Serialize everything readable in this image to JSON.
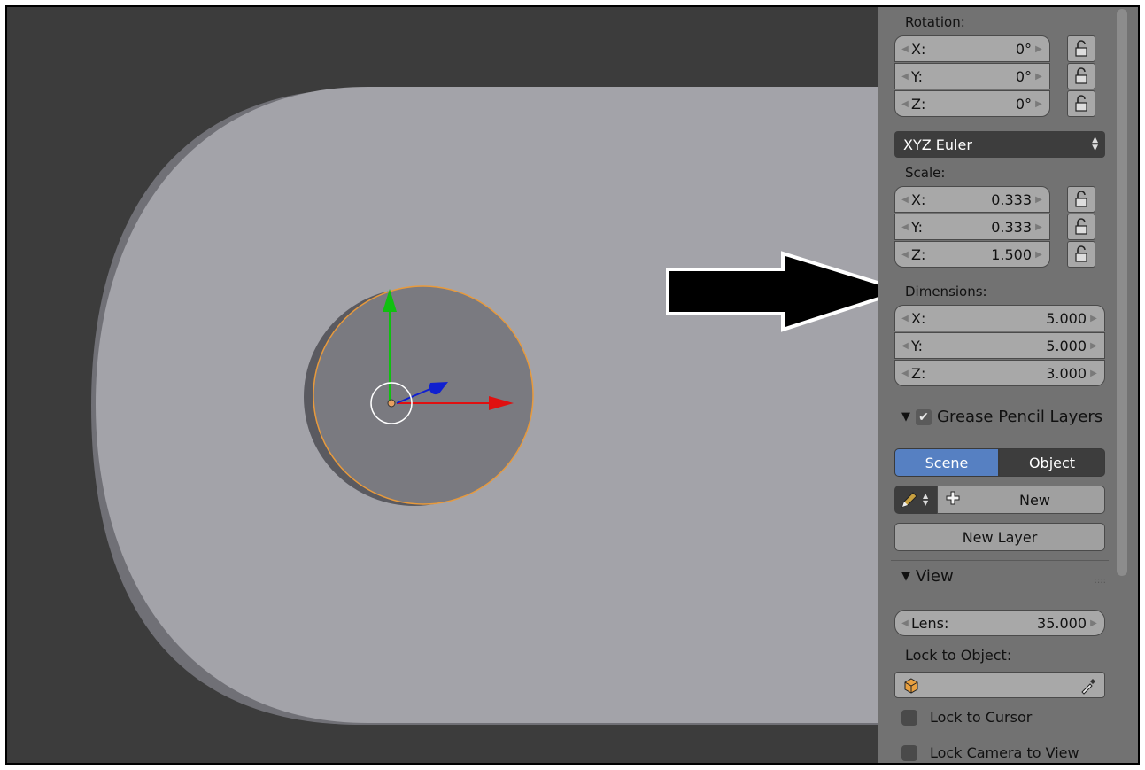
{
  "rotation": {
    "label": "Rotation:",
    "x": {
      "axis": "X:",
      "value": "0°"
    },
    "y": {
      "axis": "Y:",
      "value": "0°"
    },
    "z": {
      "axis": "Z:",
      "value": "0°"
    }
  },
  "rotation_mode": "XYZ Euler",
  "scale": {
    "label": "Scale:",
    "x": {
      "axis": "X:",
      "value": "0.333"
    },
    "y": {
      "axis": "Y:",
      "value": "0.333"
    },
    "z": {
      "axis": "Z:",
      "value": "1.500"
    }
  },
  "dimensions": {
    "label": "Dimensions:",
    "x": {
      "axis": "X:",
      "value": "5.000"
    },
    "y": {
      "axis": "Y:",
      "value": "5.000"
    },
    "z": {
      "axis": "Z:",
      "value": "3.000"
    }
  },
  "grease_pencil": {
    "title": "Grease Pencil Layers",
    "enabled": true,
    "tab_scene": "Scene",
    "tab_object": "Object",
    "active_tab": "Scene",
    "new_label": "New",
    "new_layer_label": "New Layer"
  },
  "view": {
    "title": "View",
    "lens_label": "Lens:",
    "lens_value": "35.000",
    "lock_to_object_label": "Lock to Object:",
    "lock_to_cursor_label": "Lock to Cursor",
    "lock_camera_label": "Lock Camera to View"
  },
  "colors": {
    "viewport_bg": "#3c3c3c",
    "object_face": "#a3a3a9",
    "cylinder_face": "#7a7a80",
    "selection_outline": "#e89a3c",
    "axis_x": "#e01010",
    "axis_y": "#10c010",
    "axis_z": "#1020d0",
    "active_tab": "#5680c2"
  },
  "icons": [
    "lock-icon",
    "pencil-icon",
    "plus-icon",
    "cube-icon",
    "eyedropper-icon",
    "arrow-annotation"
  ]
}
